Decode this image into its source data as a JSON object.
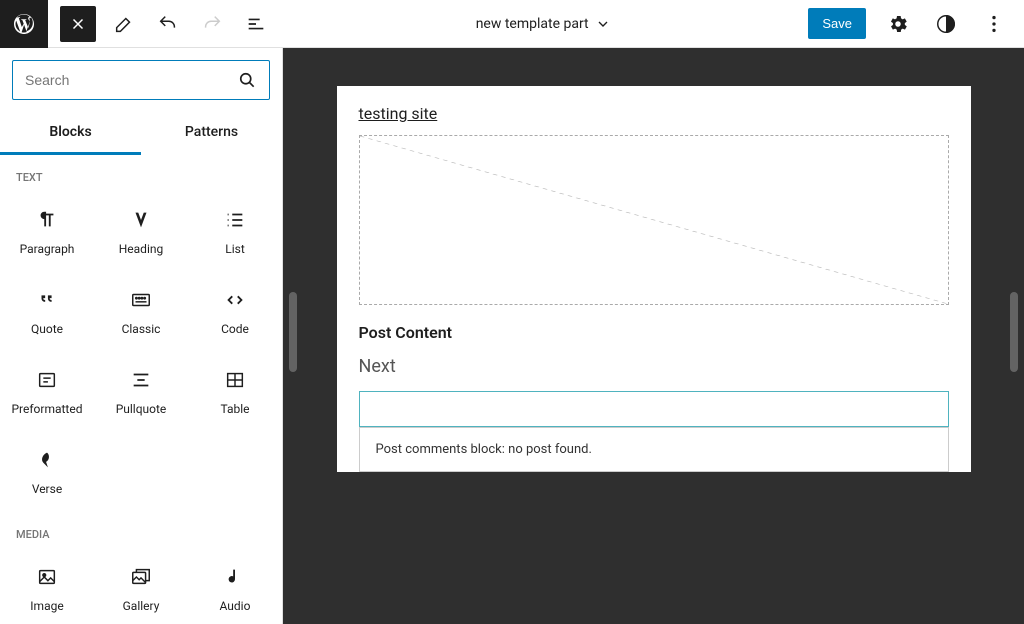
{
  "toolbar": {
    "title": "new template part",
    "save_label": "Save"
  },
  "inserter": {
    "search_placeholder": "Search",
    "tabs": [
      "Blocks",
      "Patterns"
    ],
    "sections": [
      {
        "heading": "TEXT",
        "items": [
          {
            "label": "Paragraph",
            "icon": "paragraph"
          },
          {
            "label": "Heading",
            "icon": "heading"
          },
          {
            "label": "List",
            "icon": "list"
          },
          {
            "label": "Quote",
            "icon": "quote"
          },
          {
            "label": "Classic",
            "icon": "classic"
          },
          {
            "label": "Code",
            "icon": "code"
          },
          {
            "label": "Preformatted",
            "icon": "preformatted"
          },
          {
            "label": "Pullquote",
            "icon": "pullquote"
          },
          {
            "label": "Table",
            "icon": "table"
          },
          {
            "label": "Verse",
            "icon": "verse"
          }
        ]
      },
      {
        "heading": "MEDIA",
        "items": [
          {
            "label": "Image",
            "icon": "image"
          },
          {
            "label": "Gallery",
            "icon": "gallery"
          },
          {
            "label": "Audio",
            "icon": "audio"
          }
        ]
      }
    ]
  },
  "canvas": {
    "site_title": "testing site",
    "post_content_heading": "Post Content",
    "next_heading": "Next",
    "comments_msg": "Post comments block: no post found."
  }
}
